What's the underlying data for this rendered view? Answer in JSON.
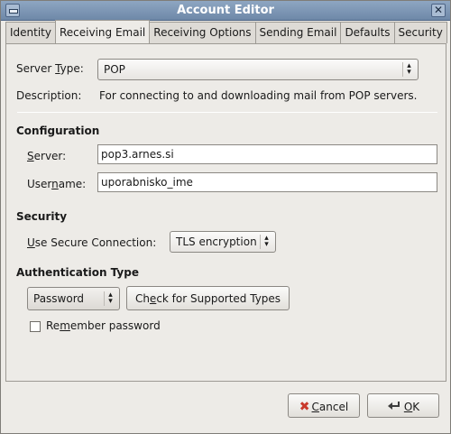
{
  "window": {
    "title": "Account Editor"
  },
  "tabs": [
    {
      "label": "Identity"
    },
    {
      "label": "Receiving Email",
      "active": true
    },
    {
      "label": "Receiving Options"
    },
    {
      "label": "Sending Email"
    },
    {
      "label": "Defaults"
    },
    {
      "label": "Security"
    }
  ],
  "server_type": {
    "label_pre": "Server ",
    "label_ul": "T",
    "label_post": "ype:",
    "value": "POP"
  },
  "description": {
    "label": "Description:",
    "text": "For connecting to and downloading mail from POP servers."
  },
  "configuration": {
    "heading": "Configuration",
    "server": {
      "label_ul": "S",
      "label_post": "erver:",
      "value": "pop3.arnes.si"
    },
    "username": {
      "label_pre": "User",
      "label_ul": "n",
      "label_post": "ame:",
      "value": "uporabnisko_ime"
    }
  },
  "security": {
    "heading": "Security",
    "secure_connection": {
      "label_ul": "U",
      "label_post": "se Secure Connection:",
      "value": "TLS encryption"
    }
  },
  "authentication": {
    "heading": "Authentication Type",
    "type_value": "Password",
    "check_button": {
      "label_pre": "Ch",
      "label_ul": "e",
      "label_post": "ck for Supported Types"
    },
    "remember": {
      "label_pre": "Re",
      "label_ul": "m",
      "label_post": "ember password",
      "checked": false
    }
  },
  "footer": {
    "cancel": {
      "label_ul": "C",
      "label_post": "ancel"
    },
    "ok": {
      "label_ul": "O",
      "label_post": "K"
    }
  }
}
